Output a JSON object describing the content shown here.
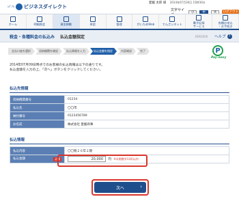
{
  "header": {
    "brand_small": "ｼｸﾞﾅﾙ",
    "brand_name": "ビジネスダイレクト",
    "user_name": "愛媛 太郎 様",
    "login_time": "2014年07月30日 15時30分",
    "font_size_label": "文字サイズ",
    "font_sizes": [
      "小",
      "中",
      "大"
    ],
    "logout_label": "ログアウト"
  },
  "nav": {
    "items": [
      {
        "label": "ホーム",
        "icon": "home-icon"
      },
      {
        "label": "明細照会",
        "icon": "statement-icon"
      },
      {
        "label": "資金移動",
        "icon": "transfer-icon"
      },
      {
        "label": "承認",
        "icon": "approval-icon"
      },
      {
        "label": "管理",
        "icon": "management-icon"
      },
      {
        "label": "がいためWeb",
        "icon": "forex-icon"
      },
      {
        "label": "でんさいネット",
        "icon": "densai-icon"
      },
      {
        "label": "電子記録\nサービス",
        "icon": "e-record-icon"
      },
      {
        "label": "各種お申込\n・お手続き",
        "icon": "application-icon"
      }
    ]
  },
  "title_bar": {
    "title": "税金・各種料金の払込み",
    "subtitle": "払込金額指定",
    "screen_id": "BZKS006",
    "help_label": "ヘルプ"
  },
  "steps": [
    "支払口座を選択",
    "収納機関を確認",
    "払込情報を入力",
    "払込金額を指定",
    "内容確認",
    "完了"
  ],
  "payeasy": {
    "mark": "P",
    "text": "Pay-easy"
  },
  "intro": {
    "line1": "2014年07月09日時点でのお客様の払込情報は以下の通りです。",
    "line2": "払込金額を入力の上、「次へ」ボタンをクリックしてください。"
  },
  "payee_section": {
    "title": "払込先情報",
    "rows": [
      {
        "label": "収納機関番号",
        "value": "01234"
      },
      {
        "label": "払込先",
        "value": "〇〇市"
      },
      {
        "label": "納付番号",
        "value": "0123456789"
      },
      {
        "label": "お名前",
        "value": "株式会社 愛媛商事"
      }
    ]
  },
  "payment_section": {
    "title": "払込情報",
    "rows": [
      {
        "label": "払込内容",
        "value": "〇〇税２６年２期"
      }
    ],
    "amount_label": "払込金額",
    "required_badge": "必須",
    "amount_value": "20,000",
    "amount_unit": "円",
    "amount_note": "※半角数字11桁以内"
  },
  "next_button_label": "次へ"
}
